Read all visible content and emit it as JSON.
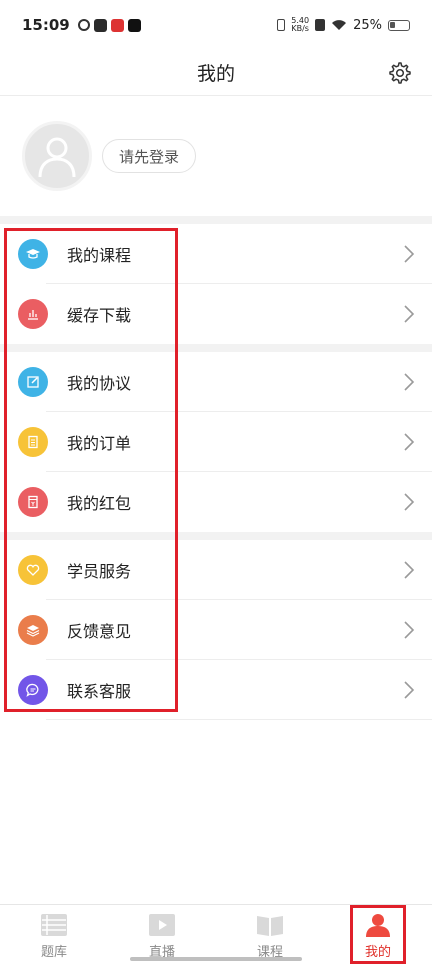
{
  "status_bar": {
    "time": "15:09",
    "net_speed_value": "5.40",
    "net_speed_unit": "KB/s",
    "battery": "25%"
  },
  "header": {
    "title": "我的"
  },
  "profile": {
    "login_label": "请先登录"
  },
  "menu_groups": [
    [
      {
        "label": "我的课程",
        "icon": "graduation-cap-icon",
        "color": "#3fb3e6"
      },
      {
        "label": "缓存下载",
        "icon": "bar-chart-icon",
        "color": "#ea5e62"
      }
    ],
    [
      {
        "label": "我的协议",
        "icon": "edit-icon",
        "color": "#3fb3e6"
      },
      {
        "label": "我的订单",
        "icon": "document-icon",
        "color": "#f7c338"
      },
      {
        "label": "我的红包",
        "icon": "red-packet-icon",
        "color": "#ea5e62"
      }
    ],
    [
      {
        "label": "学员服务",
        "icon": "heart-icon",
        "color": "#f7c338"
      },
      {
        "label": "反馈意见",
        "icon": "stack-icon",
        "color": "#ea7d4b"
      },
      {
        "label": "联系客服",
        "icon": "chat-bubble-icon",
        "color": "#7256e8"
      }
    ]
  ],
  "bottom_nav": [
    {
      "label": "题库",
      "icon": "list-icon",
      "active": false
    },
    {
      "label": "直播",
      "icon": "play-icon",
      "active": false
    },
    {
      "label": "课程",
      "icon": "book-icon",
      "active": false
    },
    {
      "label": "我的",
      "icon": "person-icon",
      "active": true
    }
  ],
  "colors": {
    "accent": "#e0302a",
    "highlight": "#e0202a"
  }
}
